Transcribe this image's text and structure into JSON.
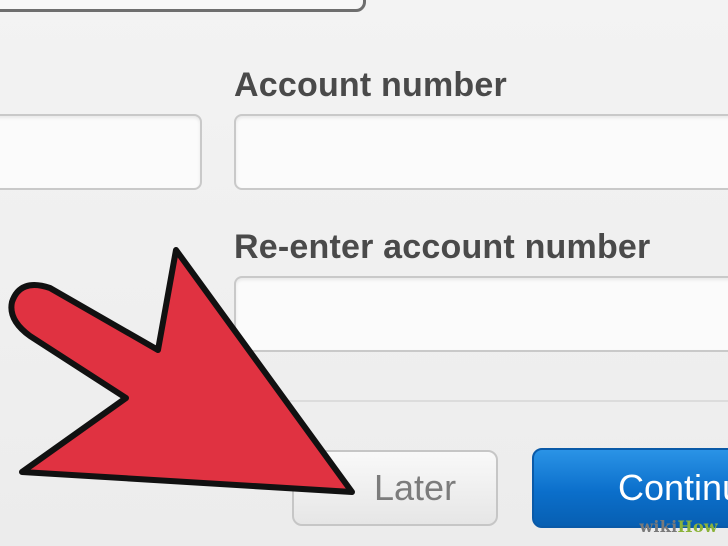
{
  "form": {
    "account_number_label": "Account number",
    "reenter_account_number_label": "Re-enter account number",
    "account_number_value": "",
    "reenter_account_number_value": "",
    "left_field_value": ""
  },
  "buttons": {
    "later_label": "Later",
    "continue_label": "Continu"
  },
  "overlay": {
    "arrow_icon": "arrow-pointer-icon",
    "arrow_fill": "#e03241",
    "arrow_outline": "#111111",
    "continue_button_color": "#0b6fcb"
  },
  "watermark": {
    "prefix": "wiki",
    "suffix": "How"
  }
}
